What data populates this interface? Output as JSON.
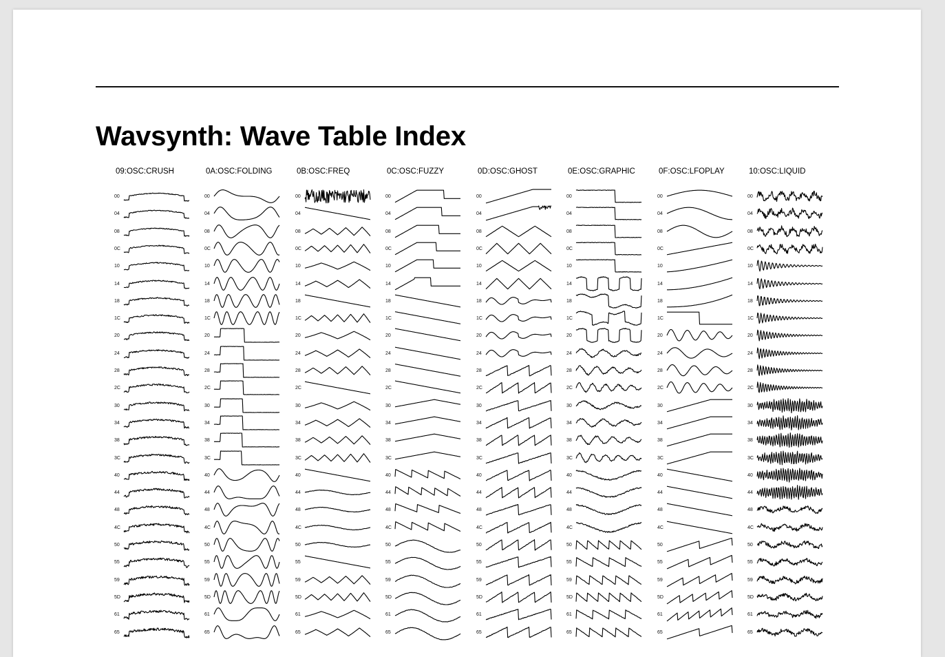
{
  "document": {
    "title": "Wavsynth: Wave Table Index"
  },
  "row_labels": [
    "00",
    "04",
    "08",
    "0C",
    "10",
    "14",
    "18",
    "1C",
    "20",
    "24",
    "28",
    "2C",
    "30",
    "34",
    "38",
    "3C",
    "40",
    "44",
    "48",
    "4C",
    "50",
    "55",
    "59",
    "5D",
    "61",
    "65"
  ],
  "columns": [
    {
      "title": "09:OSC:CRUSH",
      "kind": "crush"
    },
    {
      "title": "0A:OSC:FOLDING",
      "kind": "folding"
    },
    {
      "title": "0B:OSC:FREQ",
      "kind": "freq"
    },
    {
      "title": "0C:OSC:FUZZY",
      "kind": "fuzzy"
    },
    {
      "title": "0D:OSC:GHOST",
      "kind": "ghost"
    },
    {
      "title": "0E:OSC:GRAPHIC",
      "kind": "graphic"
    },
    {
      "title": "0F:OSC:LFOPLAY",
      "kind": "lfoplay"
    },
    {
      "title": "10:OSC:LIQUID",
      "kind": "liquid"
    }
  ]
}
